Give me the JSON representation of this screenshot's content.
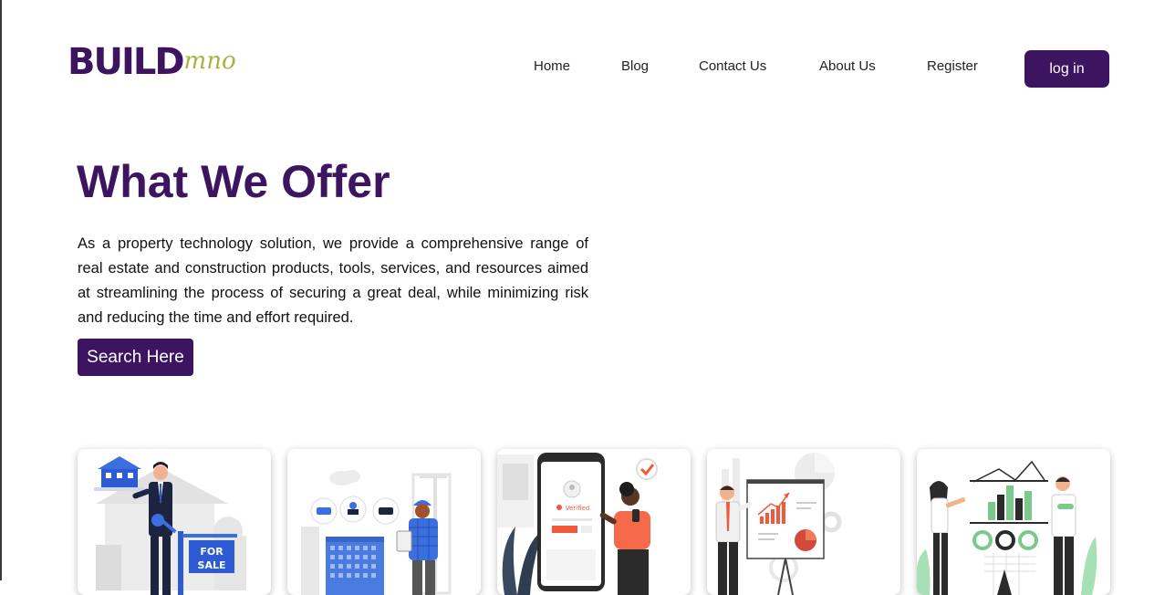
{
  "header": {
    "logo": {
      "primary": "BUILD",
      "secondary": "mno"
    },
    "nav": [
      {
        "label": "Home"
      },
      {
        "label": "Blog"
      },
      {
        "label": "Contact Us"
      },
      {
        "label": "About Us"
      },
      {
        "label": "Register"
      }
    ],
    "login_label": "log in"
  },
  "hero": {
    "title": "What We Offer",
    "description": "As a property technology solution, we provide a comprehensive range of real estate and construction products, tools, services, and resources aimed at streamlining the process of securing a great deal, while minimizing risk and reducing the time and effort required.",
    "search_label": "Search Here"
  },
  "cards": [
    {
      "illustration": "real-estate-agent-illustration",
      "sign_line1": "FOR",
      "sign_line2": "SALE"
    },
    {
      "illustration": "construction-worker-illustration"
    },
    {
      "illustration": "verified-phone-illustration",
      "badge": "Verified"
    },
    {
      "illustration": "presentation-chart-illustration"
    },
    {
      "illustration": "data-analytics-illustration"
    }
  ],
  "colors": {
    "brand": "#3d1460",
    "accent": "#a7b33e",
    "background": "#ffffff"
  }
}
